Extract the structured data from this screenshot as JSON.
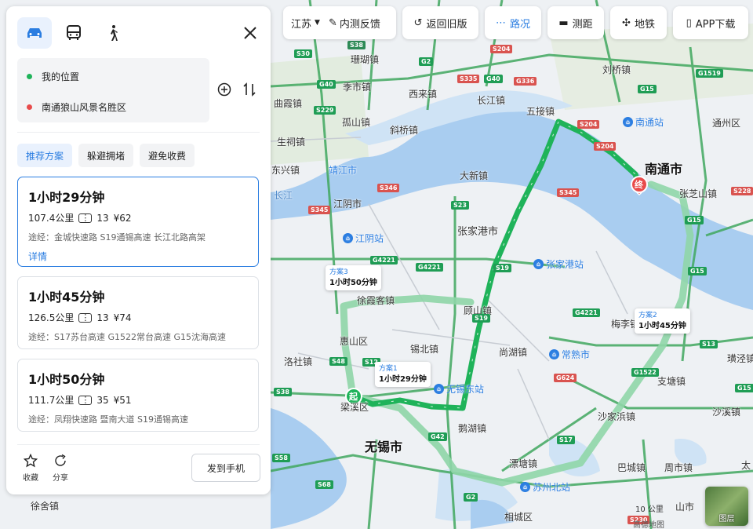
{
  "toolbar": {
    "province": "江苏",
    "feedback": "内测反馈",
    "old_version": "返回旧版",
    "traffic": "路况",
    "measure": "测距",
    "subway": "地铁",
    "app_download": "APP下载"
  },
  "panel": {
    "modes": [
      "drive",
      "bus",
      "walk"
    ],
    "origin": "我的位置",
    "destination": "南通狼山风景名胜区",
    "pref_tabs": [
      "推荐方案",
      "躲避拥堵",
      "避免收费"
    ],
    "plans": [
      {
        "time": "1小时29分钟",
        "distance": "107.4公里",
        "lights": "13",
        "cost": "¥62",
        "via": "途经：金城快速路 S19通锡高速 长江北路高架",
        "detail": "详情"
      },
      {
        "time": "1小时45分钟",
        "distance": "126.5公里",
        "lights": "13",
        "cost": "¥74",
        "via": "途经：S17苏台高速 G1522常台高速 G15沈海高速"
      },
      {
        "time": "1小时50分钟",
        "distance": "111.7公里",
        "lights": "35",
        "cost": "¥51",
        "via": "途经：凤翔快速路 暨南大道 S19通锡高速"
      }
    ],
    "collect": "收藏",
    "share": "分享",
    "send_phone": "发到手机"
  },
  "map": {
    "route_tags": [
      {
        "name": "方案1",
        "time": "1小时29分钟"
      },
      {
        "name": "方案2",
        "time": "1小时45分钟"
      },
      {
        "name": "方案3",
        "time": "1小时50分钟"
      }
    ],
    "start_marker": "起",
    "end_marker": "终",
    "cities": [
      "南通市",
      "无锡市"
    ],
    "labels": [
      "珊瑚镇",
      "季市镇",
      "西来镇",
      "长江镇",
      "五接镇",
      "刘桥镇",
      "曲霞镇",
      "孤山镇",
      "斜桥镇",
      "通州区",
      "生祠镇",
      "大新镇",
      "东兴镇",
      "靖江市",
      "张芝山镇",
      "长江",
      "江阴市",
      "张家港市",
      "徐霞客镇",
      "顾山镇",
      "惠山区",
      "锡北镇",
      "尚湖镇",
      "梅李镇",
      "璜泾镇",
      "洛社镇",
      "支塘镇",
      "沙家浜镇",
      "沙溪镇",
      "鹅湖镇",
      "梁溪区",
      "滨湖镇",
      "巴城镇",
      "周市镇",
      "徐舍镇",
      "相城区",
      "太",
      "山市",
      "漂塘镇"
    ],
    "stations": [
      "南通站",
      "江阴站",
      "张家港站",
      "常熟市",
      "无锡东站",
      "苏州北站"
    ],
    "shields": [
      "S30",
      "G40",
      "S229",
      "G2",
      "G40",
      "S38",
      "S335",
      "G336",
      "S204",
      "G1519",
      "G15",
      "S204",
      "S204",
      "S228",
      "S345",
      "G4221",
      "S23",
      "S19",
      "S346",
      "G4221",
      "S345",
      "G4221",
      "S19",
      "G15",
      "G15",
      "S13",
      "G1522",
      "G15",
      "S48",
      "S12",
      "S38",
      "G42",
      "G624",
      "S17",
      "G2",
      "S58",
      "S68",
      "S230",
      "G4221"
    ],
    "layer_label": "图层",
    "scale_label": "10 公里",
    "copyright": "高德地图"
  },
  "colors": {
    "accent": "#2a7de1",
    "route_primary": "#1fb35a",
    "route_alt": "#8fd6a8",
    "water": "#a9cdf0",
    "land": "#eef1f4",
    "highway": "#34a65a"
  }
}
